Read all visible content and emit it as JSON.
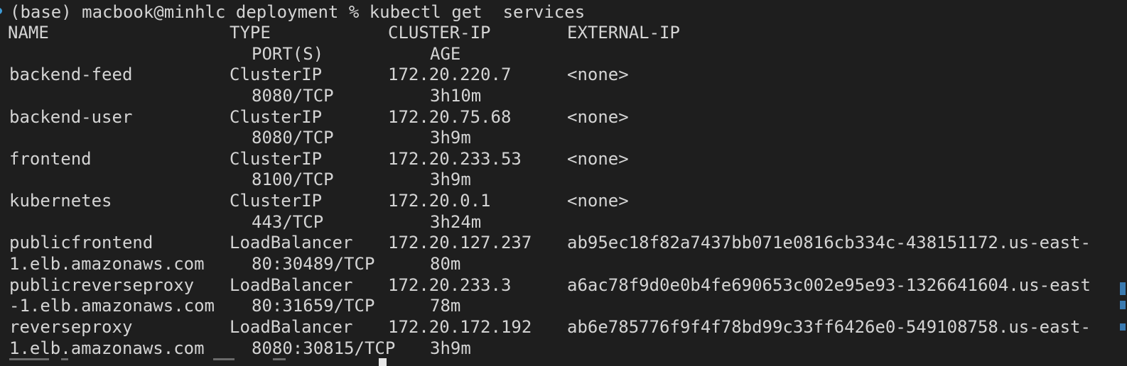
{
  "prompt": {
    "command_line": "(base) macbook@minhlc deployment % kubectl get  services"
  },
  "table": {
    "headers": {
      "name": "NAME",
      "type": "TYPE",
      "cluster_ip": "CLUSTER-IP",
      "external_ip": "EXTERNAL-IP",
      "ports": "PORT(S)",
      "age": "AGE"
    },
    "rows": [
      {
        "name": "backend-feed",
        "type": "ClusterIP",
        "cluster_ip": "172.20.220.7",
        "external_ip": "<none>",
        "name_cont": "",
        "ports": "8080/TCP",
        "age": "3h10m"
      },
      {
        "name": "backend-user",
        "type": "ClusterIP",
        "cluster_ip": "172.20.75.68",
        "external_ip": "<none>",
        "name_cont": "",
        "ports": "8080/TCP",
        "age": "3h9m"
      },
      {
        "name": "frontend",
        "type": "ClusterIP",
        "cluster_ip": "172.20.233.53",
        "external_ip": "<none>",
        "name_cont": "",
        "ports": "8100/TCP",
        "age": "3h9m"
      },
      {
        "name": "kubernetes",
        "type": "ClusterIP",
        "cluster_ip": "172.20.0.1",
        "external_ip": "<none>",
        "name_cont": "",
        "ports": "443/TCP",
        "age": "3h24m"
      },
      {
        "name": "publicfrontend",
        "type": "LoadBalancer",
        "cluster_ip": "172.20.127.237",
        "external_ip": "ab95ec18f82a7437bb071e0816cb334c-438151172.us-east-",
        "name_cont": "1.elb.amazonaws.com",
        "ports": "80:30489/TCP",
        "age": "80m"
      },
      {
        "name": "publicreverseproxy",
        "type": "LoadBalancer",
        "cluster_ip": "172.20.233.3",
        "external_ip": "a6ac78f9d0e0b4fe690653c002e95e93-1326641604.us-east",
        "name_cont": "-1.elb.amazonaws.com",
        "ports": "80:31659/TCP",
        "age": "78m"
      },
      {
        "name": "reverseproxy",
        "type": "LoadBalancer",
        "cluster_ip": "172.20.172.192",
        "external_ip": "ab6e785776f9f4f78bd99c33ff6426e0-549108758.us-east-",
        "name_cont": "1.elb.amazonaws.com",
        "ports": "8080:30815/TCP",
        "age": "3h9m"
      }
    ]
  },
  "colors": {
    "background": "#1e1e1e",
    "foreground": "#d4d4d4",
    "accent": "#3e9bd7"
  }
}
